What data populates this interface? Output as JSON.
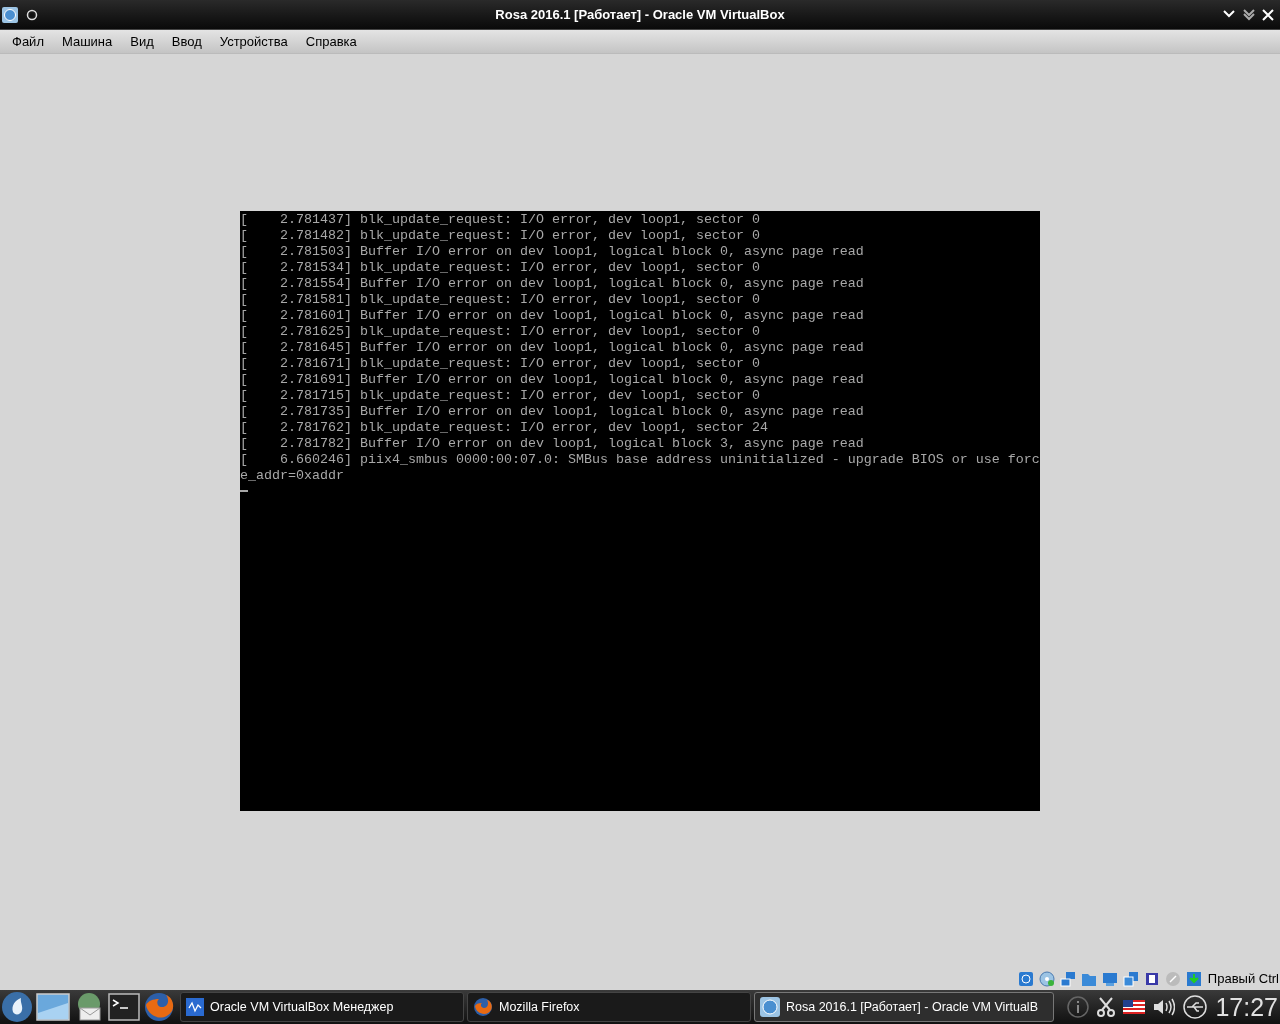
{
  "window": {
    "title": "Rosa 2016.1 [Работает] - Oracle VM VirtualBox"
  },
  "menu": [
    "Файл",
    "Машина",
    "Вид",
    "Ввод",
    "Устройства",
    "Справка"
  ],
  "console": {
    "lines": [
      "[    2.781437] blk_update_request: I/O error, dev loop1, sector 0",
      "[    2.781482] blk_update_request: I/O error, dev loop1, sector 0",
      "[    2.781503] Buffer I/O error on dev loop1, logical block 0, async page read",
      "[    2.781534] blk_update_request: I/O error, dev loop1, sector 0",
      "[    2.781554] Buffer I/O error on dev loop1, logical block 0, async page read",
      "[    2.781581] blk_update_request: I/O error, dev loop1, sector 0",
      "[    2.781601] Buffer I/O error on dev loop1, logical block 0, async page read",
      "[    2.781625] blk_update_request: I/O error, dev loop1, sector 0",
      "[    2.781645] Buffer I/O error on dev loop1, logical block 0, async page read",
      "[    2.781671] blk_update_request: I/O error, dev loop1, sector 0",
      "[    2.781691] Buffer I/O error on dev loop1, logical block 0, async page read",
      "[    2.781715] blk_update_request: I/O error, dev loop1, sector 0",
      "[    2.781735] Buffer I/O error on dev loop1, logical block 0, async page read",
      "[    2.781762] blk_update_request: I/O error, dev loop1, sector 24",
      "[    2.781782] Buffer I/O error on dev loop1, logical block 3, async page read",
      "[    6.660246] piix4_smbus 0000:00:07.0: SMBus base address uninitialized - upgrade BIOS or use forc",
      "e_addr=0xaddr"
    ]
  },
  "status_bar": {
    "host_key": "Правый Ctrl"
  },
  "taskbar": {
    "tasks": [
      {
        "label": "Oracle VM VirtualBox Менеджер",
        "selected": false
      },
      {
        "label": "Mozilla Firefox",
        "selected": false
      },
      {
        "label": "Rosa 2016.1 [Работает] - Oracle VM VirtualB",
        "selected": true
      }
    ],
    "clock": "17:27"
  }
}
